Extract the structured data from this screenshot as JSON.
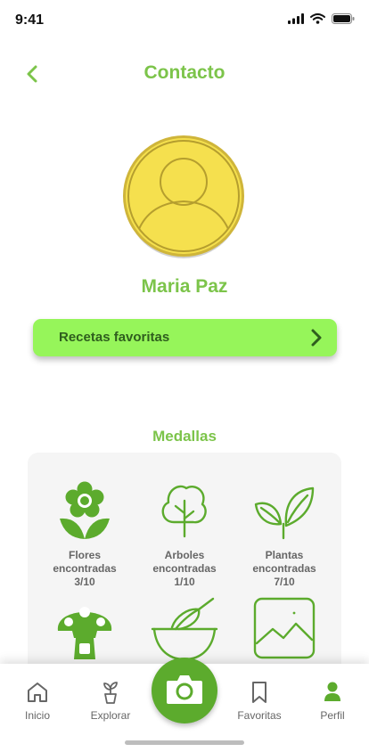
{
  "status_bar": {
    "time": "9:41"
  },
  "header": {
    "title": "Contacto",
    "back_icon": "chevron-left-icon"
  },
  "profile": {
    "name": "Maria Paz",
    "avatar_icon": "user-avatar-icon"
  },
  "favorites_button": {
    "label": "Recetas favoritas",
    "icon": "chevron-right-icon"
  },
  "medals": {
    "title": "Medallas",
    "items": [
      {
        "line1": "Flores",
        "line2": "encontradas",
        "count": "3/10",
        "icon": "flower-icon"
      },
      {
        "line1": "Arboles",
        "line2": "encontradas",
        "count": "1/10",
        "icon": "tree-icon"
      },
      {
        "line1": "Plantas",
        "line2": "encontradas",
        "count": "7/10",
        "icon": "leaf-plant-icon"
      },
      {
        "icon": "mushroom-icon"
      },
      {
        "icon": "whisk-bowl-icon"
      },
      {
        "icon": "landscape-picture-icon"
      }
    ]
  },
  "tab_bar": {
    "tabs": [
      {
        "label": "Inicio",
        "icon": "home-icon"
      },
      {
        "label": "Explorar",
        "icon": "potted-plant-icon"
      },
      {
        "label": "Favoritas",
        "icon": "bookmark-icon"
      },
      {
        "label": "Perfil",
        "icon": "user-icon"
      }
    ],
    "camera_icon": "camera-icon"
  },
  "colors": {
    "accent": "#7cc44a",
    "button_bg": "#96f55a",
    "button_text": "#2f5e1e",
    "medal_green": "#5cab2d",
    "avatar_yellow": "#f5e04e",
    "card_bg": "#f5f5f5"
  }
}
